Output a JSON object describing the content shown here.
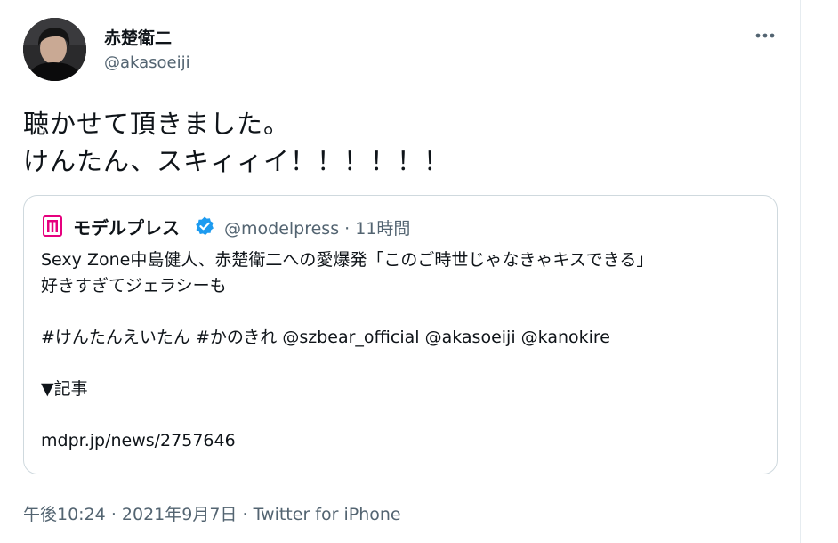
{
  "author": {
    "display_name": "赤楚衛二",
    "handle": "@akasoeiji"
  },
  "icons": {
    "avatar": "profile-photo",
    "more": "more-dots-icon",
    "quote_logo": "modelpress-logo-icon",
    "verified": "verified-badge-icon"
  },
  "tweet": {
    "line1": "聴かせて頂きました。",
    "line2": "けんたん、スキィィイ！！！！！！"
  },
  "quote": {
    "name": "モデルプレス",
    "handle": "@modelpress",
    "separator": "·",
    "time": "11時間",
    "body_line1": "Sexy Zone中島健人、赤楚衛二への愛爆発「このご時世じゃなきゃキスできる」",
    "body_line2": "好きすぎてジェラシーも",
    "hashtags": "#けんたんえいたん #かのきれ @szbear_official @akasoeiji @kanokire",
    "article_label": "▼記事",
    "link": "mdpr.jp/news/2757646"
  },
  "footer": {
    "time": "午後10:24",
    "sep1": "·",
    "date": "2021年9月7日",
    "sep2": "·",
    "source": "Twitter for iPhone"
  },
  "colors": {
    "text": "#0f1419",
    "secondary": "#536471",
    "border": "#cfd9de",
    "verified": "#1d9bf0",
    "logo": "#e6007e"
  }
}
